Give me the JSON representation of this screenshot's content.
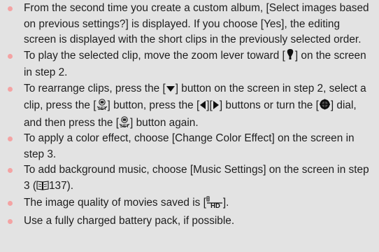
{
  "notes": [
    {
      "text": "From the second time you create a custom album, [Select images based on previous settings?] is displayed. If you choose [Yes], the editing screen is displayed with the short clips in the previously selected order."
    },
    {
      "before": "To play the selected clip, move the zoom lever toward [",
      "after": "] on the screen in step 2."
    },
    {
      "t1": "To rearrange clips, press the [",
      "t2": "] button on the screen in step 2, select a clip, press the [",
      "t3": "] button, press the [",
      "t4": "][",
      "t5": "] buttons or turn the [",
      "t6": "] dial, and then press the [",
      "t7": "] button again."
    },
    {
      "text": "To apply a color effect, choose [Change Color Effect] on the screen in step 3."
    },
    {
      "before": "To add background music, choose [Music Settings] on the screen in step 3 (",
      "page": "137",
      "after": ")."
    },
    {
      "before": "The image quality of movies saved is [",
      "after": "]."
    },
    {
      "text": "Use a fully charged battery pack, if possible."
    }
  ],
  "colors": {
    "background": "#e3e3e3",
    "bullet": "#f4a3a3",
    "text": "#1e1e1e"
  },
  "icons": {
    "zoom_playback": "magnifier-playback-icon",
    "down_button": "down-arrow-icon",
    "func_set_button": "func-set-icon",
    "left_button": "left-arrow-icon",
    "right_button": "right-arrow-icon",
    "control_dial": "control-dial-icon",
    "book": "book-icon",
    "hd_quality": "hd-movie-quality-icon"
  }
}
